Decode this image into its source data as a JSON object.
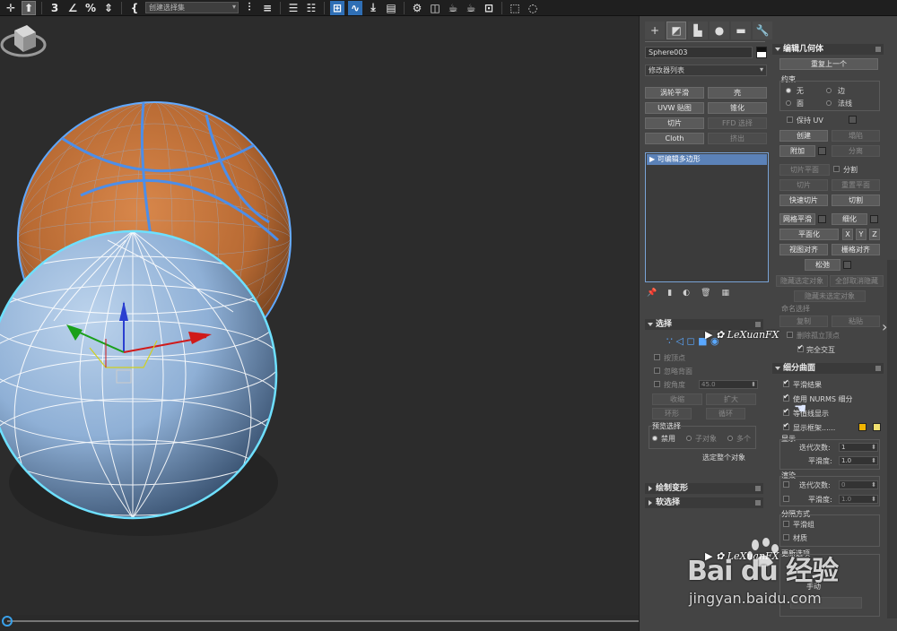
{
  "toolbar": {
    "selection_set_label": "创建选择集",
    "icons": [
      "select-move-icon",
      "select-object-icon",
      "snap-3-icon",
      "angle-snap-icon",
      "percent-snap-icon",
      "spinner-snap-icon",
      "edit-named-sets-icon",
      "mirror-icon",
      "align-icon",
      "layer-explorer-icon",
      "ribbon-icon",
      "curve-editor-icon",
      "schematic-view-icon",
      "material-editor-icon",
      "render-setup-icon",
      "render-frame-icon",
      "render-icon",
      "viewport-layout-icon"
    ]
  },
  "command_panel": {
    "tabs": [
      "create",
      "modify",
      "hierarchy",
      "motion",
      "display",
      "utilities"
    ],
    "object_name": "Sphere003",
    "modifier_list": "修改器列表",
    "modifier_buttons": [
      {
        "label": "涡轮平滑",
        "disabled": false
      },
      {
        "label": "壳",
        "disabled": false
      },
      {
        "label": "UVW 贴图",
        "disabled": false
      },
      {
        "label": "锥化",
        "disabled": false
      },
      {
        "label": "切片",
        "disabled": false
      },
      {
        "label": "FFD 选择",
        "disabled": true
      },
      {
        "label": "Cloth",
        "disabled": false
      },
      {
        "label": "挤出",
        "disabled": true
      }
    ],
    "stack_item": "可编辑多边形",
    "selection_rollout": {
      "title": "选择",
      "by_vertex": "按顶点",
      "ignore_backfacing": "忽略背面",
      "by_angle": "按角度",
      "angle_value": "45.0",
      "shrink": "收缩",
      "grow": "扩大",
      "ring": "环形",
      "loop": "循环",
      "preview_title": "预览选择",
      "preview_disabled": "禁用",
      "preview_subobject": "子对象",
      "preview_multi": "多个",
      "selected_whole": "选定整个对象"
    },
    "soft_selection_title": "软选择",
    "paint_deform_title": "绘制变形",
    "edit_geometry": {
      "title": "编辑几何体",
      "repeat_last": "重复上一个",
      "constraints": "约束",
      "c_none": "无",
      "c_edge": "边",
      "c_face": "面",
      "c_normal": "法线",
      "preserve_uv": "保持 UV",
      "create": "创建",
      "collapse": "塌陷",
      "attach": "附加",
      "detach": "分离",
      "slice_plane": "切片平面",
      "split": "分割",
      "slice": "切片",
      "reset_plane": "重置平面",
      "quickslice": "快速切片",
      "cut": "切割",
      "meshsmooth": "网格平滑",
      "tessellate": "细化",
      "make_planar": "平面化",
      "x": "X",
      "y": "Y",
      "z": "Z",
      "view_align": "视图对齐",
      "grid_align": "栅格对齐",
      "relax": "松弛",
      "hide_selected": "隐藏选定对象",
      "unhide_all": "全部取消隐藏",
      "hide_unselected": "隐藏未选定对象",
      "named_selections": "命名选择",
      "copy": "复制",
      "paste": "粘贴",
      "delete_isolated": "删除孤立顶点",
      "full_interactivity": "完全交互"
    },
    "subdivision_surface": {
      "title": "细分曲面",
      "smooth_result": "平滑结果",
      "use_nurms": "使用 NURMS 细分",
      "isoline_display": "等值线显示",
      "show_cage": "显示框架......",
      "display": "显示",
      "iterations": "迭代次数:",
      "iterations_val": "1",
      "smoothness": "平滑度:",
      "smoothness_val": "1.0",
      "render": "渲染",
      "r_iterations": "迭代次数:",
      "r_iterations_val": "0",
      "r_smoothness": "平滑度:",
      "r_smoothness_val": "1.0",
      "separate_by": "分隔方式",
      "smoothing_groups": "平滑组",
      "materials": "材质",
      "update_options": "更新选项",
      "manual": "手动"
    },
    "colors": {
      "cage_color_1": "#f0b400",
      "cage_color_2": "#f0e070",
      "stack_highlight": "#5b82b8"
    }
  },
  "watermark": {
    "logo_text": "LeXuanFX",
    "brand": "Bai du 经验",
    "url": "jingyan.baidu.com"
  }
}
